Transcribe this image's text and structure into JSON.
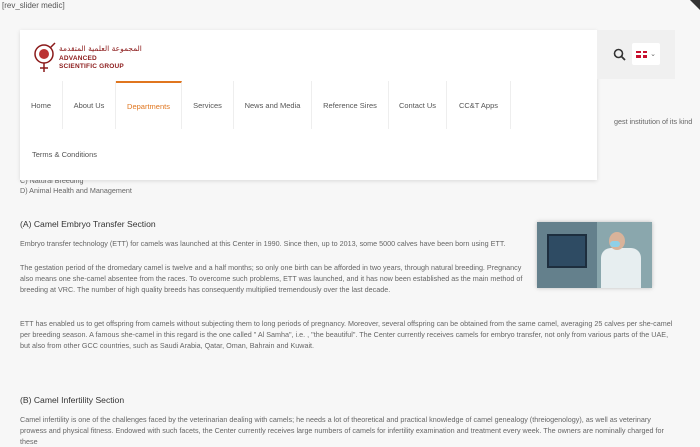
{
  "slider_code": "[rev_slider medic]",
  "header": {
    "logo": {
      "arabic_name": "المجموعة العلمية المتقدمة",
      "english_line1": "ADVANCED",
      "english_line2": "SCIENTIFIC GROUP"
    },
    "nav": [
      {
        "label": "Home"
      },
      {
        "label": "About Us"
      },
      {
        "label": "Departments"
      },
      {
        "label": "Services"
      },
      {
        "label": "News and Media"
      },
      {
        "label": "Reference Sires"
      },
      {
        "label": "Contact Us"
      },
      {
        "label": "CC&T Apps"
      }
    ],
    "nav_row2": "Terms & Conditions",
    "active_item": "Departments",
    "accent_color": "#e0761f"
  },
  "content": {
    "partial_right_text": "gest institution of its kind",
    "partial_list_item": "C) Natural Breeding",
    "list_item_d": "D) Animal Health and Management",
    "section_a_title": "(A) Camel Embryo Transfer Section",
    "section_a_p1": "Embryo transfer technology (ETT) for camels was launched at this Center in 1990. Since then, up to 2013, some 5000 calves have been born using ETT.",
    "section_a_p2": "The gestation period of the dromedary camel is twelve and a half months; so only one birth can be afforded in two years, through natural breeding. Pregnancy also means one she-camel absentee from the races. To overcome such problems, ETT was launched, and it has now been established as the main method of breeding at VRC. The number of high quality breeds has consequently multiplied tremendously over the last decade.",
    "section_a_p3": "ETT has enabled us to get offspring from camels without subjecting them to long periods of pregnancy. Moreover, several offspring can be obtained from the same camel, averaging 25 calves per she-camel per breeding season. A famous she-camel in this regard is the one called \" Al Samha\", i.e. , \"the beautiful\". The Center currently receives camels for embryo transfer, not only from various parts of the UAE, but also from other GCC countries, such as Saudi Arabia, Qatar, Oman, Bahrain and Kuwait.",
    "section_b_title": "(B) Camel Infertility Section",
    "section_b_p1": "Camel infertility is one of the challenges faced by the veterinarian dealing with camels; he needs a lot of theoretical and practical knowledge of camel genealogy (threiogenology), as well as veterinary prowess and physical fitness. Endowed with such facets, the Center currently receives large numbers of camels for infertility examination and treatment every week. The owners are nominally charged for these"
  },
  "icons": {
    "search": "search-icon",
    "flag": "uk-flag-icon",
    "dropdown": "chevron-down-icon"
  }
}
